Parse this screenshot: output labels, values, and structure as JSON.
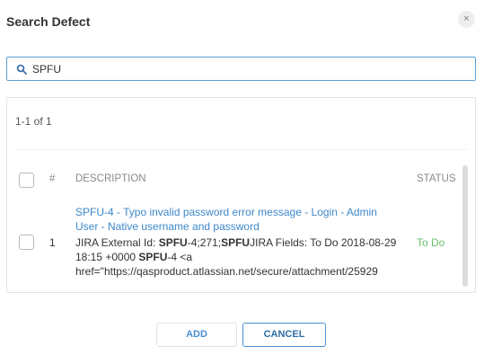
{
  "dialog": {
    "title": "Search Defect",
    "close_icon": "×"
  },
  "search": {
    "value": "SPFU",
    "icon": "search-icon"
  },
  "results": {
    "count_label": "1-1 of 1",
    "columns": {
      "number": "#",
      "description": "Description",
      "status": "Status"
    },
    "rows": [
      {
        "number": "1",
        "title": "SPFU-4 - Typo invalid password error message - Login - Admin User - Native username and password",
        "details": [
          {
            "text": "JIRA External Id: ",
            "bold": false
          },
          {
            "text": "SPFU",
            "bold": true
          },
          {
            "text": "-4;271;",
            "bold": false
          },
          {
            "text": "SPFU",
            "bold": true
          },
          {
            "text": "JIRA Fields: To Do 2018-08-29 18:15 +0000 ",
            "bold": false
          },
          {
            "text": "SPFU",
            "bold": true
          },
          {
            "text": "-4 <a href=\"https://qasproduct.atlassian.net/secure/attachment/25929",
            "bold": false
          }
        ],
        "status": "To Do"
      }
    ]
  },
  "buttons": {
    "add": "Add",
    "cancel": "Cancel"
  },
  "colors": {
    "accent": "#4a90d2",
    "link": "#3d87c9",
    "status_todo": "#6cbf6c"
  }
}
